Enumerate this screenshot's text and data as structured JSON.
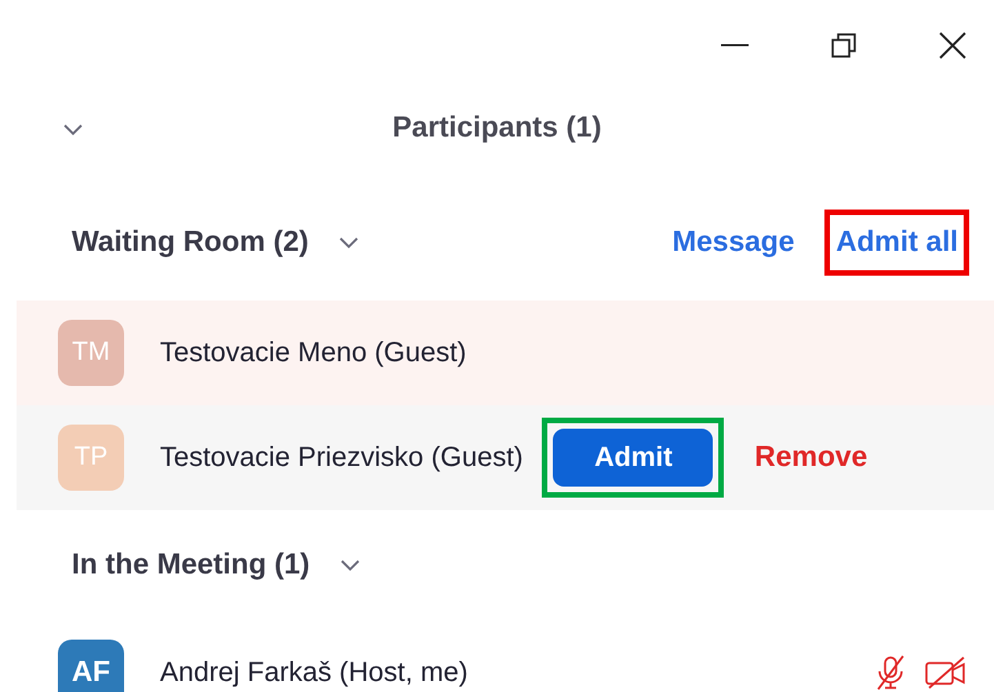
{
  "panel": {
    "title": "Participants (1)",
    "collapsed": false
  },
  "waiting_room": {
    "title": "Waiting Room (2)",
    "actions": [
      {
        "label": "Message"
      },
      {
        "label": "Admit all",
        "color": "#ee0000"
      }
    ],
    "participants": [
      {
        "initials": "TM",
        "color": "#e5b9ad",
        "name": "Testovacie Meno (Guest)",
        "kind": "attention"
      },
      {
        "initials": "TP",
        "color": "#f3cdb5",
        "name": "Testovacie Priezvisko (Guest)",
        "kind": "hovered",
        "buttons": [
          {
            "label": "Admit",
            "kind": "primary",
            "color": "#00aa44"
          },
          {
            "label": "Remove",
            "kind": "danger"
          }
        ]
      }
    ]
  },
  "meeting": {
    "title": "In the Meeting (1)",
    "participants": [
      {
        "initials": "AF",
        "color": "#2d7ab8",
        "name": "Andrej Farkaš (Host, me)",
        "audio_muted": true,
        "video_off": true
      }
    ]
  }
}
